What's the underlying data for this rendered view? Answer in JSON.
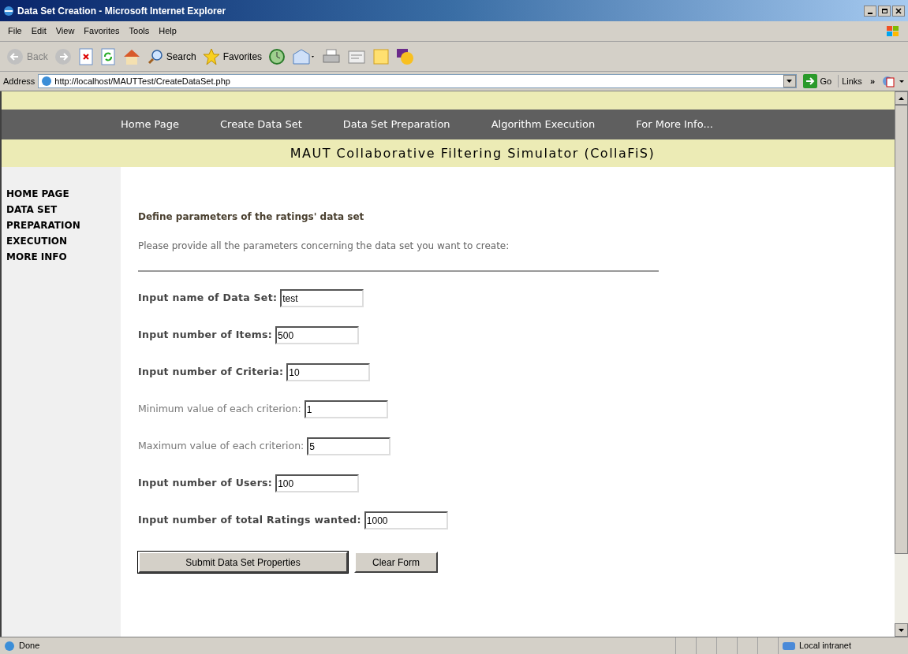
{
  "window": {
    "title": "Data Set Creation - Microsoft Internet Explorer"
  },
  "menu": [
    "File",
    "Edit",
    "View",
    "Favorites",
    "Tools",
    "Help"
  ],
  "toolbar": {
    "back": "Back",
    "search": "Search",
    "favorites": "Favorites"
  },
  "address": {
    "label": "Address",
    "url": "http://localhost/MAUTTest/CreateDataSet.php",
    "go": "Go",
    "links": "Links",
    "more": "»"
  },
  "nav": [
    "Home Page",
    "Create Data Set",
    "Data Set Preparation",
    "Algorithm Execution",
    "For More Info..."
  ],
  "banner": "MAUT Collaborative Filtering Simulator (CollaFiS)",
  "sidebar": [
    "HOME PAGE",
    "DATA SET",
    "PREPARATION",
    "EXECUTION",
    "MORE INFO"
  ],
  "heading": "Define parameters of the ratings' data set",
  "intro": "Please provide all the parameters concerning the data set you want to create:",
  "fields": [
    {
      "label": "Input name of Data Set:",
      "value": "test",
      "bold": true
    },
    {
      "label": "Input number of Items:",
      "value": "500",
      "bold": true
    },
    {
      "label": "Input number of Criteria:",
      "value": "10",
      "bold": true
    },
    {
      "label": "Minimum value of each criterion:",
      "value": "1",
      "bold": false
    },
    {
      "label": "Maximum value of each criterion:",
      "value": "5",
      "bold": false
    },
    {
      "label": "Input number of Users:",
      "value": "100",
      "bold": true
    },
    {
      "label": "Input number of total Ratings wanted:",
      "value": "1000",
      "bold": true
    }
  ],
  "buttons": [
    "Submit Data Set Properties",
    "Clear Form"
  ],
  "status_bar": {
    "text": "Done",
    "zone": "Local intranet"
  }
}
